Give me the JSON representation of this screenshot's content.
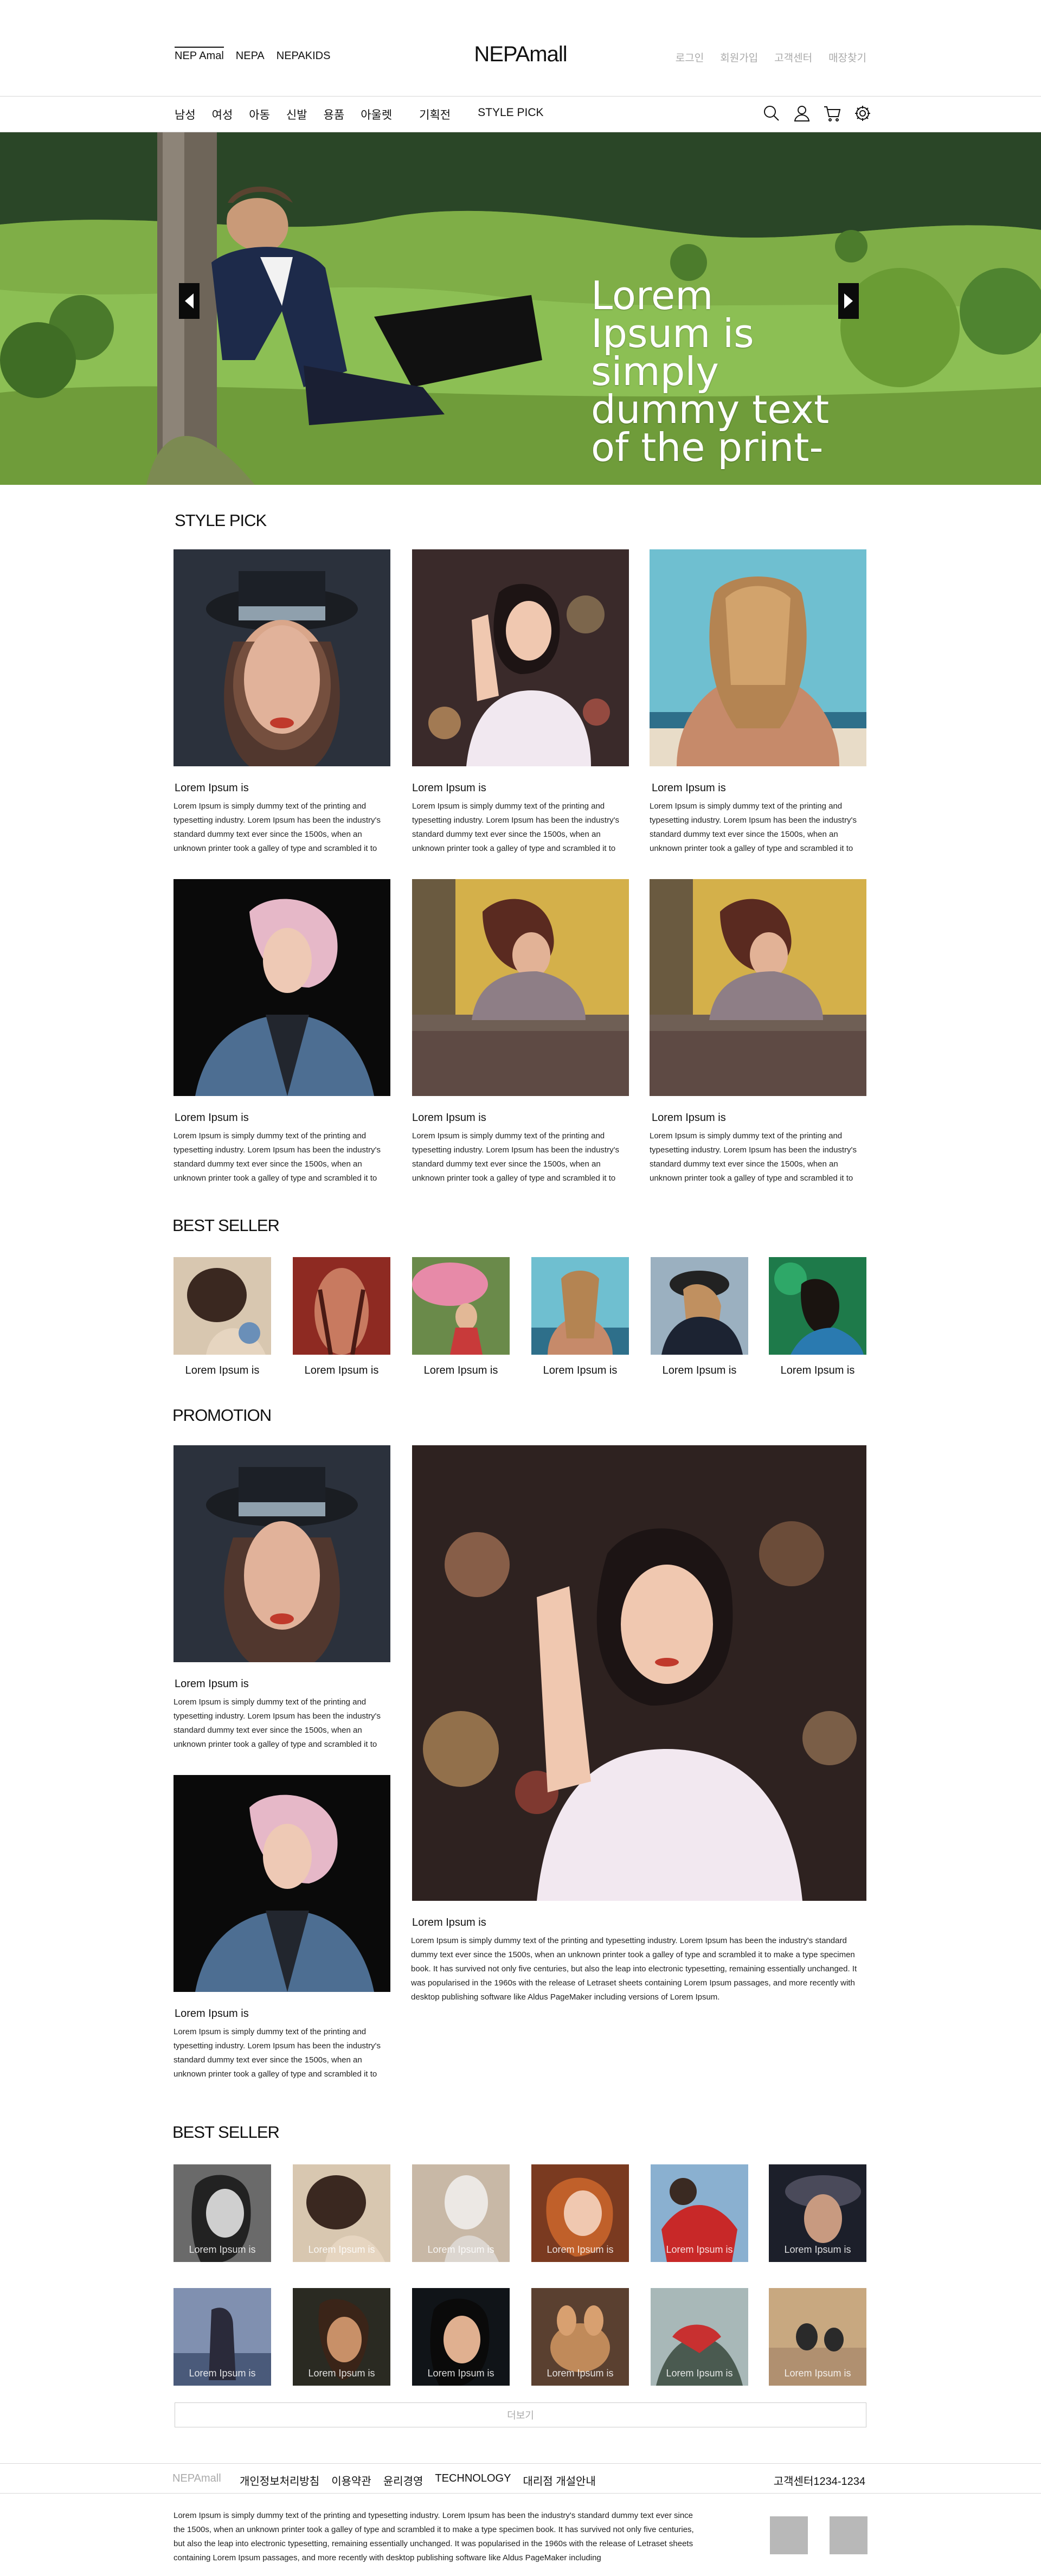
{
  "header": {
    "brands": [
      "NEP Amal",
      "NEPA",
      "NEPAKIDS"
    ],
    "logo": "NEPAmall",
    "util": [
      "로그인",
      "회원가입",
      "고객센터",
      "매장찾기"
    ]
  },
  "gnb": {
    "items": [
      "남성",
      "여성",
      "아동",
      "신발",
      "용품",
      "아울렛",
      "기획전",
      "STYLE PICK"
    ],
    "icons": [
      "search-icon",
      "user-icon",
      "cart-icon",
      "settings-icon"
    ]
  },
  "hero": {
    "text": "Lorem Ipsum is simply dummy text of the print-"
  },
  "style_pick": {
    "title": "STYLE PICK",
    "cards": [
      {
        "title": "Lorem Ipsum is",
        "desc": "Lorem Ipsum is simply dummy text of the printing and typesetting industry. Lorem Ipsum has been the industry's standard dummy text ever since the 1500s, when an unknown printer took a galley of type and scrambled it to"
      },
      {
        "title": "Lorem Ipsum is",
        "desc": "Lorem Ipsum is simply dummy text of the printing and typesetting industry. Lorem Ipsum has been the industry's standard dummy text ever since the 1500s, when an unknown printer took a galley of type and scrambled it to"
      },
      {
        "title": "Lorem Ipsum is",
        "desc": "Lorem Ipsum is simply dummy text of the printing and typesetting industry. Lorem Ipsum has been the industry's standard dummy text ever since the 1500s, when an unknown printer took a galley of type and scrambled it to"
      },
      {
        "title": "Lorem Ipsum is",
        "desc": "Lorem Ipsum is simply dummy text of the printing and typesetting industry. Lorem Ipsum has been the industry's standard dummy text ever since the 1500s, when an unknown printer took a galley of type and scrambled it to"
      },
      {
        "title": "Lorem Ipsum is",
        "desc": "Lorem Ipsum is simply dummy text of the printing and typesetting industry. Lorem Ipsum has been the industry's standard dummy text ever since the 1500s, when an unknown printer took a galley of type and scrambled it to"
      },
      {
        "title": "Lorem Ipsum is",
        "desc": "Lorem Ipsum is simply dummy text of the printing and typesetting industry. Lorem Ipsum has been the industry's standard dummy text ever since the 1500s, when an unknown printer took a galley of type and scrambled it to"
      }
    ]
  },
  "best_seller_1": {
    "title": "BEST SELLER",
    "items": [
      "Lorem Ipsum is",
      "Lorem Ipsum is",
      "Lorem Ipsum is",
      "Lorem Ipsum is",
      "Lorem Ipsum is",
      "Lorem Ipsum is"
    ]
  },
  "promotion": {
    "title": "PROMOTION",
    "small": [
      {
        "title": "Lorem Ipsum is",
        "desc": "Lorem Ipsum is simply dummy text of the printing and typesetting industry. Lorem Ipsum has been the industry's standard dummy text ever since the 1500s, when an unknown printer took a galley of type and scrambled it to"
      },
      {
        "title": "Lorem Ipsum is",
        "desc": "Lorem Ipsum is simply dummy text of the printing and typesetting industry. Lorem Ipsum has been the industry's standard dummy text ever since the 1500s, when an unknown printer took a galley of type and scrambled it to"
      }
    ],
    "large": {
      "title": "Lorem Ipsum is",
      "desc": "Lorem Ipsum is simply dummy text of the printing and typesetting industry. Lorem Ipsum has been the industry's standard dummy text ever since the 1500s, when an unknown printer took a galley of type and scrambled it to make a type specimen book. It has survived not only five centuries, but also the leap into electronic typesetting, remaining essentially unchanged. It was popularised in the 1960s with the release of Letraset sheets containing Lorem Ipsum passages, and more recently with desktop publishing software like Aldus PageMaker including versions of Lorem Ipsum."
    }
  },
  "best_seller_2": {
    "title": "BEST SELLER",
    "items": [
      "Lorem Ipsum is",
      "Lorem Ipsum is",
      "Lorem Ipsum is",
      "Lorem Ipsum is",
      "Lorem Ipsum is",
      "Lorem Ipsum is",
      "Lorem Ipsum is",
      "Lorem Ipsum is",
      "Lorem Ipsum is",
      "Lorem Ipsum is",
      "Lorem Ipsum is",
      "Lorem Ipsum is"
    ],
    "more_label": "더보기"
  },
  "footer": {
    "logo": "NEPAmall",
    "links": [
      "개인정보처리방침",
      "이용약관",
      "윤리경영",
      "TECHNOLOGY",
      "대리점 개설안내"
    ],
    "cs": "고객센터1234-1234",
    "desc": "Lorem Ipsum is simply dummy text of the printing and typesetting industry. Lorem Ipsum has been the industry's standard dummy text ever since the 1500s, when an unknown printer took a galley of type and scrambled it to make a type specimen book. It has survived not only five centuries, but also the leap into electronic typesetting, remaining essentially unchanged. It was popularised in the 1960s with the release of Letraset sheets containing Lorem Ipsum passages, and more recently with desktop publishing software like Aldus PageMaker including"
  }
}
